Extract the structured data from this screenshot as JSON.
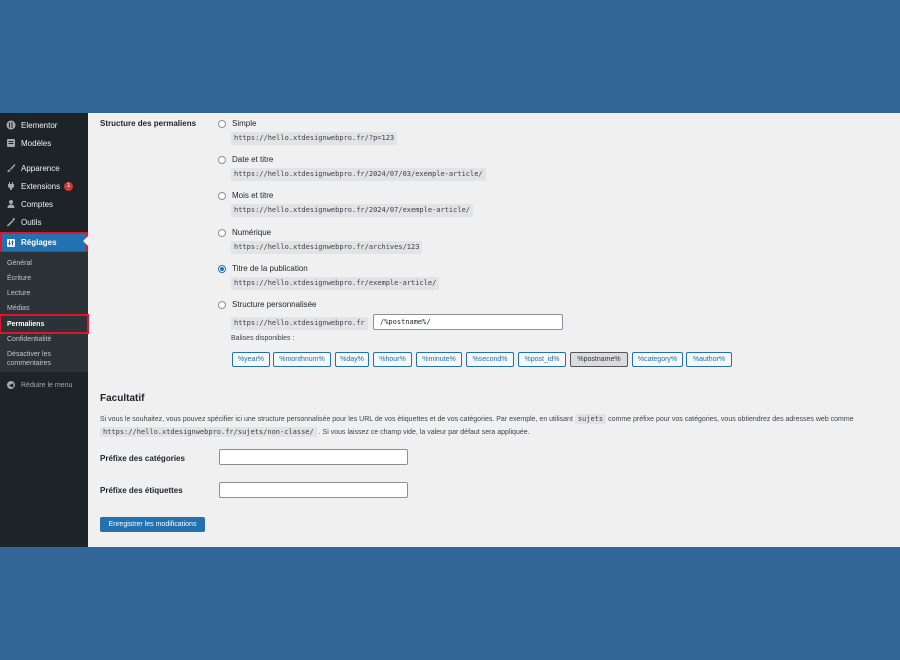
{
  "sidebar": {
    "items": [
      {
        "label": "Elementor",
        "icon": "elementor-icon"
      },
      {
        "label": "Modèles",
        "icon": "templates-icon"
      },
      {
        "label": "Apparence",
        "icon": "brush-icon"
      },
      {
        "label": "Extensions",
        "icon": "plugin-icon",
        "badge": "1"
      },
      {
        "label": "Comptes",
        "icon": "user-icon"
      },
      {
        "label": "Outils",
        "icon": "wrench-icon"
      },
      {
        "label": "Réglages",
        "icon": "settings-icon"
      }
    ],
    "submenu": [
      "Général",
      "Écriture",
      "Lecture",
      "Médias",
      "Permaliens",
      "Confidentialité",
      "Désactiver les commentaires"
    ],
    "collapse_label": "Réduire le menu"
  },
  "permalinks": {
    "title": "Structure des permaliens",
    "options": [
      {
        "label": "Simple",
        "example": "https://hello.xtdesignwebpro.fr/?p=123"
      },
      {
        "label": "Date et titre",
        "example": "https://hello.xtdesignwebpro.fr/2024/07/03/exemple-article/"
      },
      {
        "label": "Mois et titre",
        "example": "https://hello.xtdesignwebpro.fr/2024/07/exemple-article/"
      },
      {
        "label": "Numérique",
        "example": "https://hello.xtdesignwebpro.fr/archives/123"
      },
      {
        "label": "Titre de la publication",
        "example": "https://hello.xtdesignwebpro.fr/exemple-article/"
      },
      {
        "label": "Structure personnalisée",
        "example": "https://hello.xtdesignwebpro.fr"
      }
    ],
    "selected": "Titre de la publication",
    "custom_value": "/%postname%/",
    "tags_label": "Balises disponibles :",
    "tags": [
      "%year%",
      "%monthnum%",
      "%day%",
      "%hour%",
      "%minute%",
      "%second%",
      "%post_id%",
      "%postname%",
      "%category%",
      "%author%"
    ],
    "active_tag": "%postname%"
  },
  "optional": {
    "title": "Facultatif",
    "desc_part1": "Si vous le souhaitez, vous pouvez spécifier ici une structure personnalisée pour les URL de vos étiquettes et de vos catégories. Par exemple, en utilisant",
    "desc_code1": "sujets",
    "desc_part2": "comme préfixe pour vos catégories, vous obtiendrez des adresses web comme",
    "desc_code2": "https://hello.xtdesignwebpro.fr/sujets/non-classe/",
    "desc_part3": ". Si vous laissez ce champ vide, la valeur par défaut sera appliquée.",
    "category_label": "Préfixe des catégories",
    "tag_label": "Préfixe des étiquettes",
    "category_value": "",
    "tag_value": ""
  },
  "submit_label": "Enregistrer les modifications",
  "colors": {
    "accent": "#2271b1",
    "sidebar": "#1d2327",
    "highlight": "#e0142a",
    "frame": "#336699"
  }
}
